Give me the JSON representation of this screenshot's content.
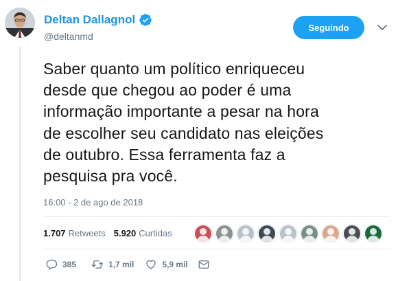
{
  "author": {
    "display_name": "Deltan Dallagnol",
    "handle": "@deltanmd",
    "verified": true
  },
  "follow_button": {
    "label": "Seguindo"
  },
  "tweet": {
    "text": "Saber quanto um político enriqueceu\ndesde que chegou ao poder é uma\ninformação importante a pesar na hora\nde escolher seu candidato nas eleições\nde outubro. Essa ferramenta faz a\npesquisa pra você.",
    "timestamp": "16:00 - 2 de ago de 2018"
  },
  "stats": {
    "retweets_count": "1.707",
    "retweets_label": "Retweets",
    "likes_count": "5.920",
    "likes_label": "Curtidas"
  },
  "liker_avatars": [
    {
      "color": "#c94f58"
    },
    {
      "color": "#8a9391"
    },
    {
      "color": "#b8c2cb"
    },
    {
      "color": "#3d4a57"
    },
    {
      "color": "#b8c2cb"
    },
    {
      "color": "#7a8f88"
    },
    {
      "color": "#d9a88e"
    },
    {
      "color": "#4a4f55"
    },
    {
      "color": "#1c6b3f"
    }
  ],
  "actions": {
    "reply_count": "385",
    "retweet_count": "1,7 mil",
    "like_count": "5,9 mil"
  },
  "colors": {
    "link_blue": "#1da1f2",
    "name_blue": "#1b95e0",
    "muted_gray": "#657786",
    "text_dark": "#14171a"
  },
  "icons": {
    "verified": "verified-badge-icon",
    "menu": "chevron-down-icon",
    "reply": "reply-icon",
    "retweet": "retweet-icon",
    "like": "heart-icon",
    "dm": "envelope-icon"
  }
}
